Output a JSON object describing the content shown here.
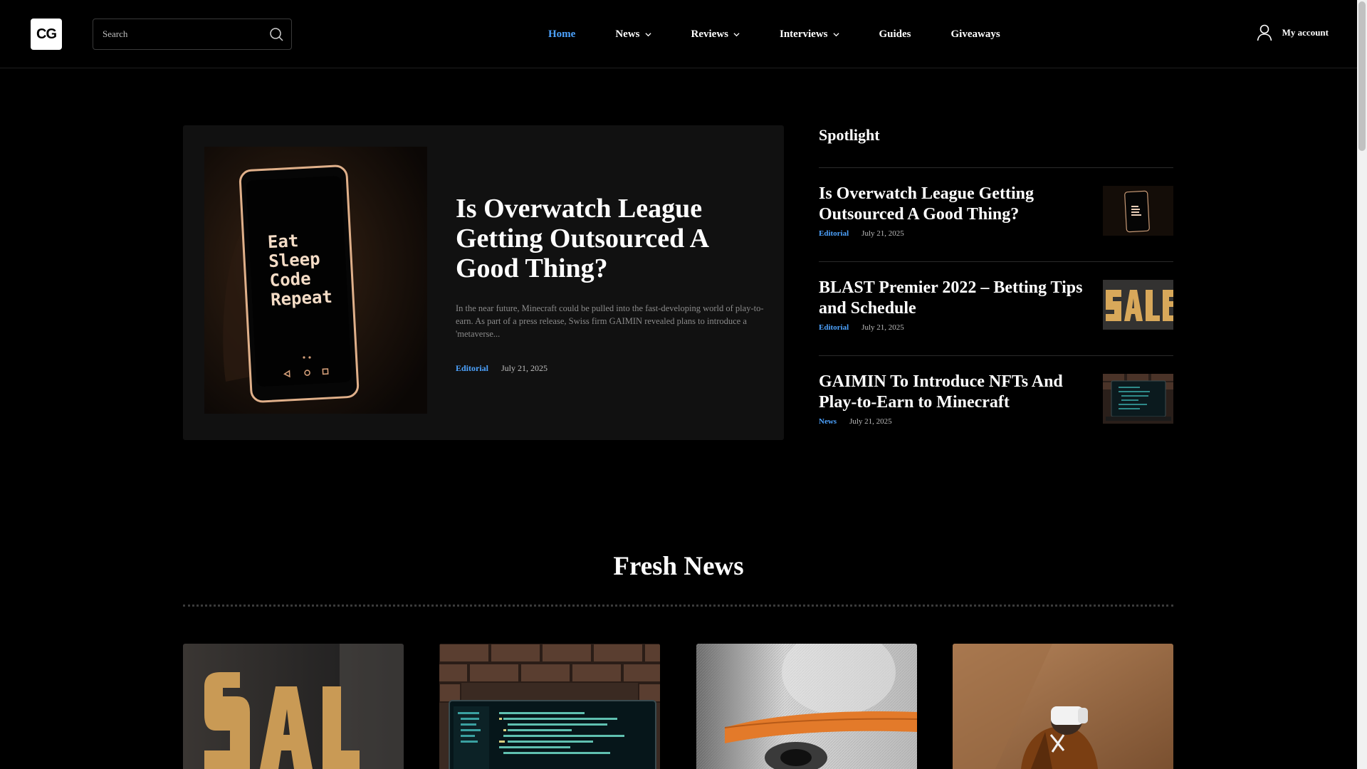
{
  "header": {
    "logo_text": "CG",
    "search_placeholder": "Search",
    "nav": [
      {
        "label": "Home",
        "active": true,
        "dropdown": false
      },
      {
        "label": "News",
        "active": false,
        "dropdown": true
      },
      {
        "label": "Reviews",
        "active": false,
        "dropdown": true
      },
      {
        "label": "Interviews",
        "active": false,
        "dropdown": true
      },
      {
        "label": "Guides",
        "active": false,
        "dropdown": false
      },
      {
        "label": "Giveaways",
        "active": false,
        "dropdown": false
      }
    ],
    "account_label": "My account"
  },
  "featured": {
    "title": "Is Overwatch League Getting Outsourced A Good Thing?",
    "excerpt": "In the near future, Minecraft could be pulled into the fast-developing world of play-to-earn. As part of a press release, Swiss firm GAIMIN revealed plans to introduce a 'metaverse...",
    "category": "Editorial",
    "date": "July 21, 2025",
    "phone_text": [
      "Eat",
      "Sleep",
      "Code",
      "Repeat"
    ]
  },
  "spotlight": {
    "heading": "Spotlight",
    "items": [
      {
        "title": "Is Overwatch League Getting Outsourced A Good Thing?",
        "category": "Editorial",
        "date": "July 21, 2025"
      },
      {
        "title": "BLAST Premier 2022 – Betting Tips and Schedule",
        "category": "Editorial",
        "date": "July 21, 2025"
      },
      {
        "title": "GAIMIN To Introduce NFTs And Play-to-Earn to Minecraft",
        "category": "News",
        "date": "July 21, 2025"
      }
    ]
  },
  "fresh_news": {
    "heading": "Fresh News"
  },
  "colors": {
    "accent": "#4da3ff",
    "background": "#000000",
    "card_bg": "#111111"
  }
}
